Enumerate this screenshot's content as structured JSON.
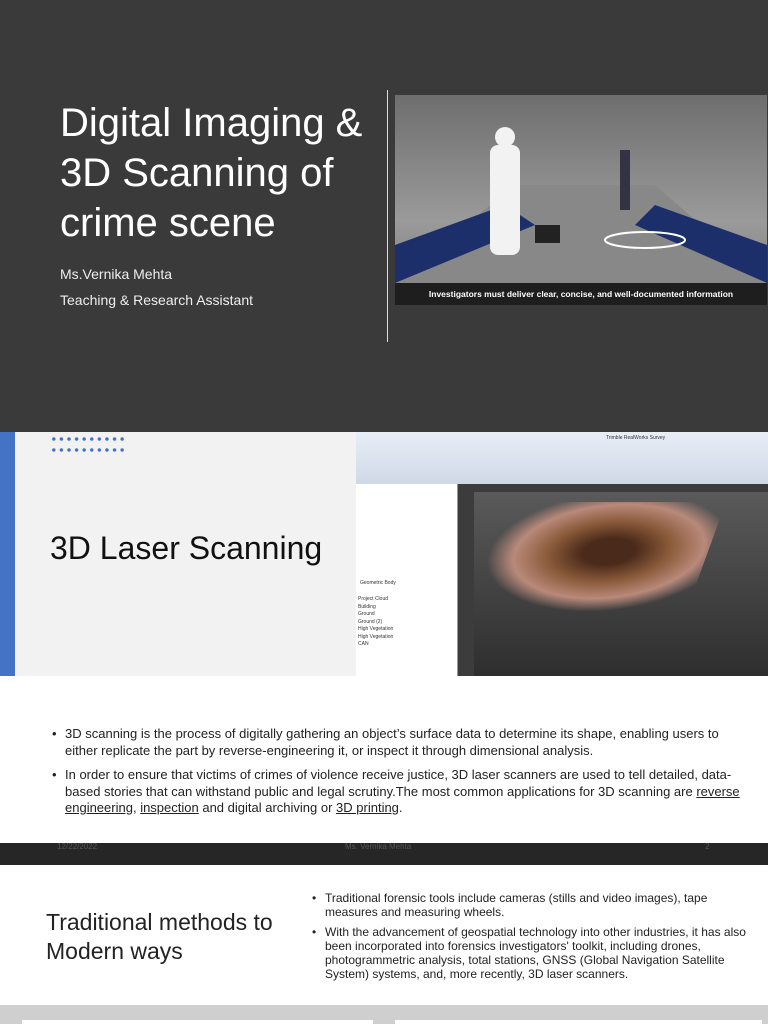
{
  "slide1": {
    "title": "Digital Imaging & 3D Scanning of crime scene",
    "author": "Ms.Vernika Mehta",
    "role": "Teaching & Research Assistant",
    "image_caption": "Investigators must deliver clear, concise, and well-documented information"
  },
  "slide2": {
    "title": "3D Laser Scanning",
    "software": {
      "title": "Trimble RealWorks Survey",
      "layer": "Geometric Body",
      "rows": [
        "Project Cloud",
        "Building",
        "Ground",
        "Ground (2)",
        "High Vegetation",
        "High Vegetation",
        "CAN"
      ]
    }
  },
  "slide2_text": {
    "bullet1": "3D scanning is the process of digitally gathering an object’s surface data to determine its shape, enabling users to either replicate the part by reverse-engineering it, or inspect it through dimensional analysis.",
    "bullet2_pre": "In order to ensure that victims of crimes of violence receive justice, 3D laser scanners are used to tell detailed, data-based stories that can withstand public and legal scrutiny.The most common applications for 3D scanning are ",
    "link1": "reverse engineering",
    "sep1": ", ",
    "link2": "inspection",
    "mid": " and digital archiving or ",
    "link3": "3D printing",
    "end": "."
  },
  "footer": {
    "date": "12/22/2022",
    "author": "Ms. Vernika Mehta",
    "page": "2"
  },
  "slide3": {
    "title": "Traditional methods to Modern ways",
    "bullet1": "Traditional forensic tools include cameras (stills and video images), tape measures and measuring wheels.",
    "bullet2": " With the advancement of geospatial technology into other industries, it has also been incorporated into forensics investigators' toolkit, including drones, photogrammetric analysis, total stations, GNSS (Global Navigation Satellite System) systems, and, more recently, 3D laser scanners."
  }
}
